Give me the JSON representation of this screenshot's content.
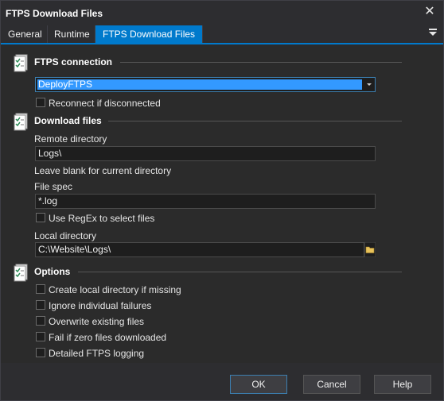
{
  "window": {
    "title": "FTPS Download Files",
    "close_glyph": "✕"
  },
  "tabs": [
    {
      "label": "General"
    },
    {
      "label": "Runtime"
    },
    {
      "label": "FTPS Download Files"
    }
  ],
  "sections": {
    "connection": {
      "title": "FTPS connection",
      "selected_connection": "DeployFTPS",
      "reconnect_label": "Reconnect if disconnected"
    },
    "download": {
      "title": "Download files",
      "remote_dir_label": "Remote directory",
      "remote_dir_value": "Logs\\",
      "remote_dir_hint": "Leave blank for current directory",
      "file_spec_label": "File spec",
      "file_spec_value": "*.log",
      "regex_label": "Use RegEx to select files",
      "local_dir_label": "Local directory",
      "local_dir_value": "C:\\Website\\Logs\\"
    },
    "options": {
      "title": "Options",
      "items": [
        {
          "label": "Create local directory if missing"
        },
        {
          "label": "Ignore individual failures"
        },
        {
          "label": "Overwrite existing files"
        },
        {
          "label": "Fail if zero files downloaded"
        },
        {
          "label": "Detailed FTPS logging"
        }
      ]
    }
  },
  "buttons": {
    "ok": "OK",
    "cancel": "Cancel",
    "help": "Help"
  },
  "colors": {
    "accent": "#007acc",
    "selection": "#3399ff",
    "background": "#2b2b2b"
  }
}
